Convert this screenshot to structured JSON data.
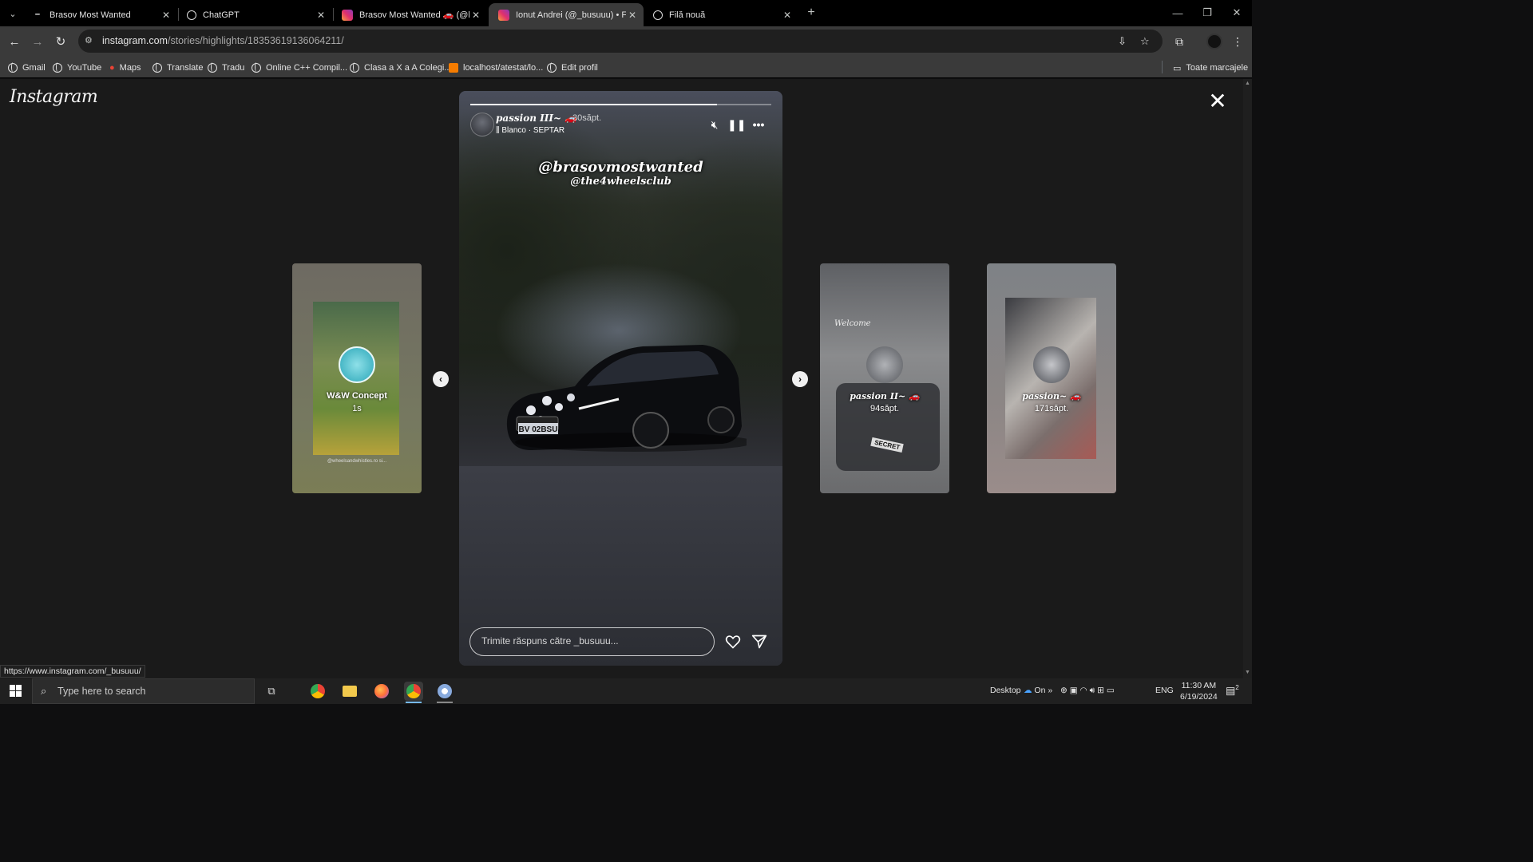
{
  "browser": {
    "tabs": [
      {
        "title": "Brasov Most Wanted",
        "active": false
      },
      {
        "title": "ChatGPT",
        "active": false
      },
      {
        "title": "Brasov Most Wanted 🚗 (@bra",
        "active": false
      },
      {
        "title": "Ionut Andrei (@_busuuu) • Foto",
        "active": true
      },
      {
        "title": "Filă nouă",
        "active": false
      }
    ],
    "url_host": "instagram.com",
    "url_path": "/stories/highlights/18353619136064211/",
    "bookmarks": [
      "Gmail",
      "YouTube",
      "Maps",
      "Translate",
      "Tradu",
      "Online C++ Compil...",
      "Clasa a X a A Colegi...",
      "localhost/atestat/lo...",
      "Edit profil"
    ],
    "all_bookmarks": "Toate marcajele"
  },
  "instagram": {
    "logo": "Instagram",
    "story": {
      "name": "passion III~ 🚗",
      "time": "30săpt.",
      "music": "Blanco · SEPTAR",
      "mention1": "@brasovmostwanted",
      "mention2": "@the4wheelsclub",
      "plate": "BV 02BSU",
      "progress_fraction": 0.82,
      "reply_placeholder": "Trimite răspuns către _busuuu..."
    },
    "previews": [
      {
        "name": "W&W Concept",
        "time": "1s",
        "caption": "@wheelsandwhistles.ro si..."
      },
      {
        "name": "passion II~ 🚗",
        "time": "94săpt.",
        "overlay": "Welcome",
        "plate": "SECRET"
      },
      {
        "name": "passion~ 🚗",
        "time": "171săpt."
      }
    ]
  },
  "status_url": "https://www.instagram.com/_busuuu/",
  "taskbar": {
    "search_placeholder": "Type here to search",
    "desktop": "Desktop",
    "weather": "On",
    "lang": "ENG",
    "time": "11:30 AM",
    "date": "6/19/2024",
    "notifications": "2"
  },
  "colors": {
    "accent": "#76b9ed",
    "instagram": "#e1306c"
  }
}
